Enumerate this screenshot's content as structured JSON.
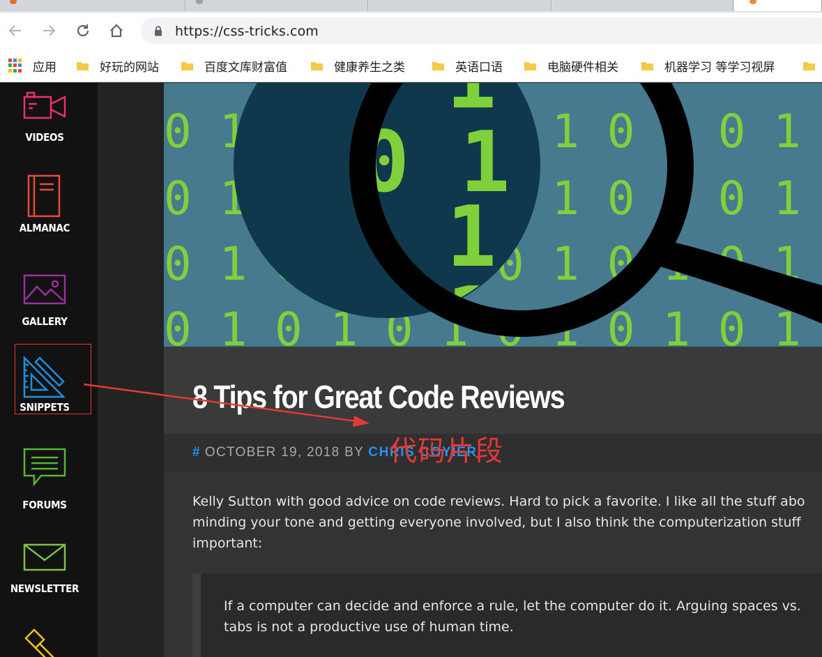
{
  "browser": {
    "url": "https://css-tricks.com",
    "bookmarks": [
      {
        "label": "应用",
        "icon": "apps-grid-icon"
      },
      {
        "label": "好玩的网站",
        "icon": "folder-icon"
      },
      {
        "label": "百度文库财富值",
        "icon": "folder-icon"
      },
      {
        "label": "健康养生之类",
        "icon": "folder-icon"
      },
      {
        "label": "英语口语",
        "icon": "folder-icon"
      },
      {
        "label": "电脑硬件相关",
        "icon": "folder-icon"
      },
      {
        "label": "机器学习 等学习视屏",
        "icon": "folder-icon"
      }
    ]
  },
  "sidebar": {
    "items": [
      {
        "label": "VIDEOS",
        "icon": "video-camera-icon",
        "color": "#e8336a"
      },
      {
        "label": "ALMANAC",
        "icon": "book-icon",
        "color": "#e84a3a"
      },
      {
        "label": "GALLERY",
        "icon": "image-icon",
        "color": "#9b2fa3"
      },
      {
        "label": "SNIPPETS",
        "icon": "set-square-icon",
        "color": "#1f8fe0"
      },
      {
        "label": "FORUMS",
        "icon": "speech-bubble-icon",
        "color": "#5ab536"
      },
      {
        "label": "NEWSLETTER",
        "icon": "envelope-icon",
        "color": "#7bc142"
      },
      {
        "label": "",
        "icon": "hammer-icon",
        "color": "#f5c518"
      }
    ]
  },
  "hero": {
    "digit_color": "#7fd03a",
    "background": "#477a8f",
    "bg_rows": [
      "0 1 0 1 0 1 0 1 0 1 0 1 0 1",
      "0 1 0 1 0 1 0 1 0 1 0 1 0 1",
      "0 1 0 1 0 1 0 1 0 1 0 1 0 1",
      "0 1 0 1 0 1 0 1 0 1 0 1 0 1"
    ],
    "lens_rows": [
      "1 0 1",
      "0 1 0 1",
      "1 0 1",
      "1 0"
    ]
  },
  "article": {
    "title": "8 Tips for Great Code Reviews",
    "meta_hash": "#",
    "meta_date": "OCTOBER 19, 2018 BY ",
    "meta_author": "CHRIS COYIER",
    "paragraph_lines": [
      "Kelly Sutton with good advice on code reviews. Hard to pick a favorite. I like all the stuff abo",
      "minding your tone and getting everyone involved, but I also think the computerization stuff",
      "important:"
    ],
    "quote_lines": [
      "If a computer can decide and enforce a rule, let the computer do it. Arguing spaces vs.",
      "tabs is not a productive use of human time."
    ]
  },
  "annotation": {
    "label": "代码片段",
    "color": "#e53935"
  }
}
